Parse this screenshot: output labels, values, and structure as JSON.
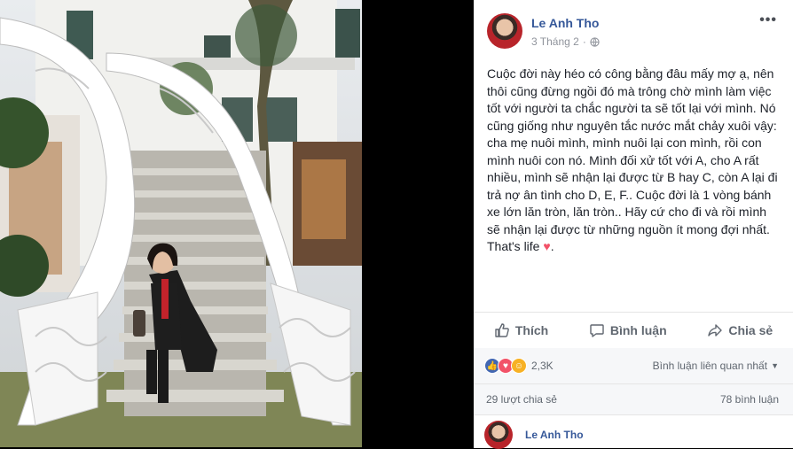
{
  "post": {
    "author": "Le Anh Tho",
    "date": "3 Tháng 2",
    "privacy_icon": "globe-icon",
    "text": "Cuộc đời này héo có công bằng đâu mấy mợ ạ, nên thôi cũng đừng ngồi đó mà trông chờ mình làm việc tốt với người ta chắc người ta sẽ tốt lại với mình. Nó cũng giống như nguyên tắc nước mắt chảy xuôi vậy: cha mẹ nuôi mình, mình nuôi lại con mình, rồi con mình nuôi con nó. Mình đối xử tốt với A, cho A rất nhiều, mình sẽ nhận lại được từ B hay C, còn A lại đi trả nợ ân tình cho D, E, F.. Cuộc đời là 1 vòng bánh xe lớn lăn tròn, lăn tròn.. Hãy cứ cho đi và rồi mình sẽ nhận lại được từ những nguồn ít mong đợi nhất. That's life",
    "emoji": "♥"
  },
  "actions": {
    "like": "Thích",
    "comment": "Bình luận",
    "share": "Chia sẻ"
  },
  "reactions": {
    "count": "2,3K",
    "sort_label": "Bình luận liên quan nhất",
    "icons": [
      "like-icon",
      "love-icon",
      "haha-icon"
    ]
  },
  "stats": {
    "shares": "29 lượt chia sẻ",
    "comments": "78 bình luận"
  },
  "comment_author": "Le Anh Tho",
  "colors": {
    "name": "#365899",
    "like": "#4267b2",
    "love": "#f25268",
    "haha": "#f7b125"
  }
}
